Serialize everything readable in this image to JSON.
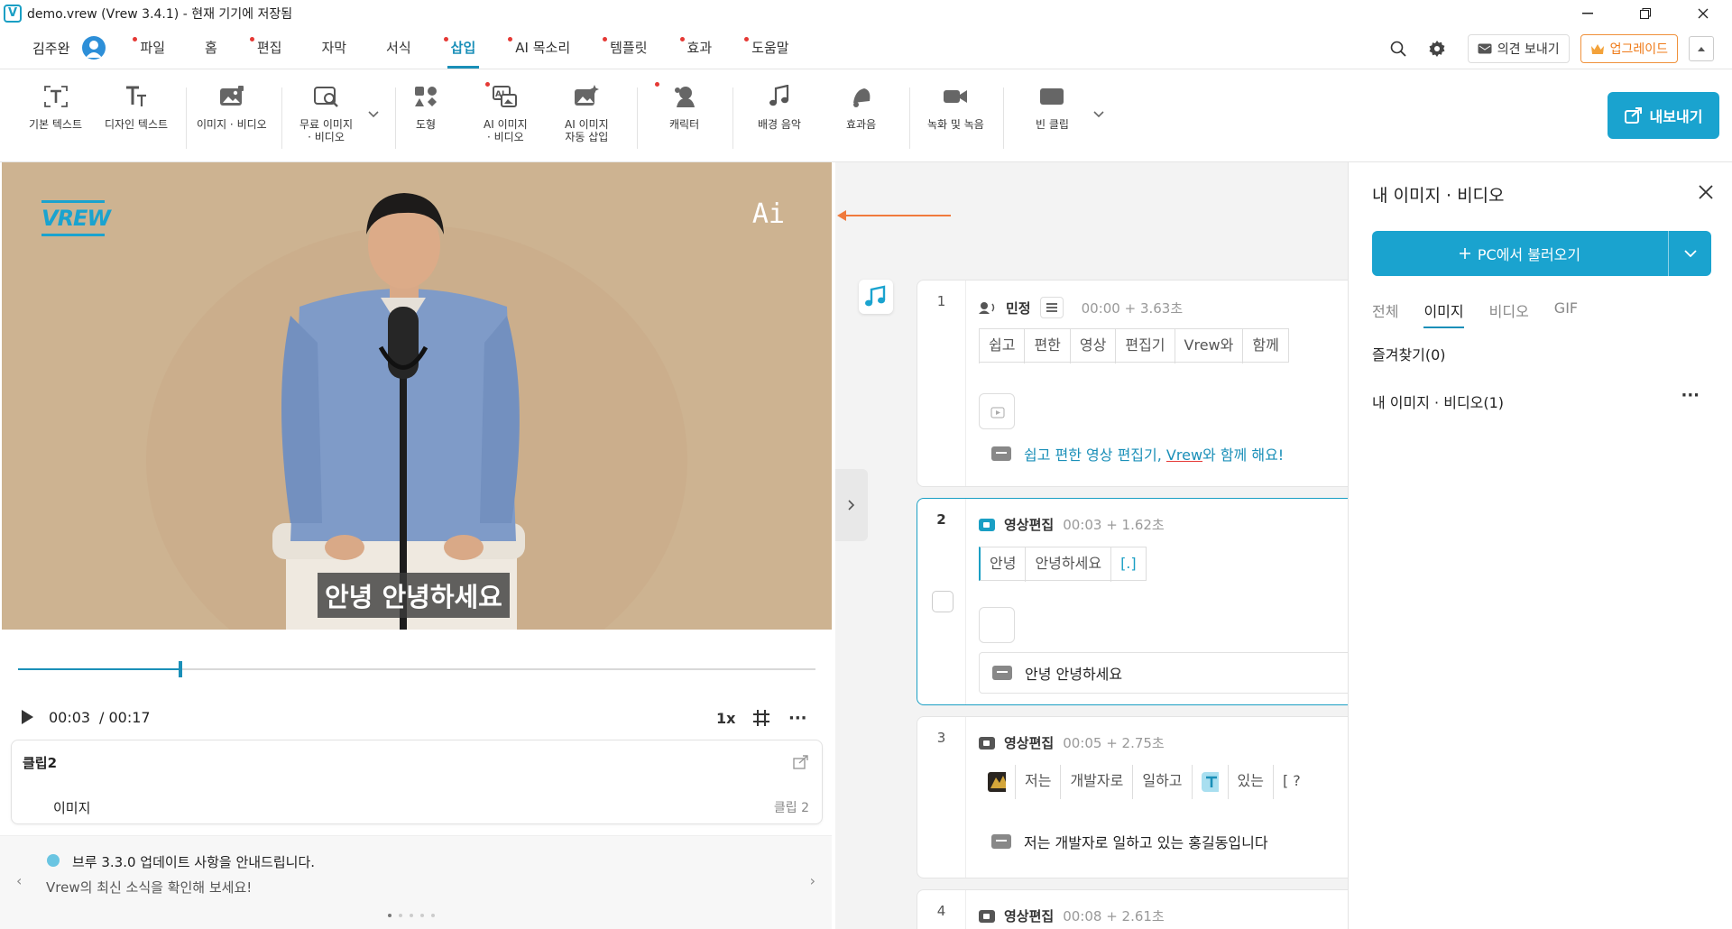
{
  "window": {
    "title": "demo.vrew (Vrew 3.4.1) - 현재 기기에 저장됨",
    "logo": "V"
  },
  "menu": {
    "user_name": "김주완",
    "items": [
      {
        "label": "파일",
        "dot": true
      },
      {
        "label": "홈",
        "dot": false
      },
      {
        "label": "편집",
        "dot": true
      },
      {
        "label": "자막",
        "dot": false
      },
      {
        "label": "서식",
        "dot": false
      },
      {
        "label": "삽입",
        "dot": true,
        "active": true
      },
      {
        "label": "AI 목소리",
        "dot": true
      },
      {
        "label": "템플릿",
        "dot": true
      },
      {
        "label": "효과",
        "dot": true
      },
      {
        "label": "도움말",
        "dot": true
      }
    ],
    "feedback_label": "의견 보내기",
    "upgrade_label": "업그레이드"
  },
  "toolbar": {
    "basic_text": "기본 텍스트",
    "design_text": "디자인 텍스트",
    "image_video": "이미지 · 비디오",
    "free_image_1": "무료 이미지",
    "free_image_2": "· 비디오",
    "shape": "도형",
    "ai_image_1": "AI 이미지",
    "ai_image_2": "· 비디오",
    "ai_auto_1": "AI 이미지",
    "ai_auto_2": "자동 삽입",
    "character": "캐릭터",
    "bgm": "배경 음악",
    "sfx": "효과음",
    "record": "녹화 및 녹음",
    "empty_clip": "빈 클립",
    "export": "내보내기"
  },
  "preview": {
    "logo_text": "VREW",
    "ai_text": "Ai",
    "subtitle": "안녕 안녕하세요",
    "progress": 0.204,
    "time_current": "00:03",
    "time_total": "/ 00:17",
    "speed": "1x",
    "more": "···"
  },
  "clip_card": {
    "title": "클립2",
    "item": "이미지",
    "clip_label": "클립 2"
  },
  "news": {
    "title": "브루 3.3.0 업데이트 사항을 안내드립니다.",
    "subtitle": "Vrew의 최신 소식을 확인해 보세요!",
    "prev": "‹",
    "next": "›"
  },
  "clips": [
    {
      "num": "1",
      "speaker": "민정",
      "time": "00:00 + 3.63초",
      "words": [
        "쉽고",
        "편한",
        "영상",
        "편집기",
        "Vrew와",
        "함께"
      ],
      "caption_a": "쉽고 편한 영상 편집기, ",
      "caption_b": "Vrew",
      "caption_c": "와 함께 해요!"
    },
    {
      "num": "2",
      "speaker": "영상편집",
      "time": "00:03 + 1.62초",
      "words": [
        "안녕",
        "안녕하세요",
        "[.]"
      ],
      "caption": "안녕 안녕하세요"
    },
    {
      "num": "3",
      "speaker": "영상편집",
      "time": "00:05 + 2.75초",
      "words": [
        "저는",
        "개발자로",
        "일하고",
        "있는",
        "[ ?"
      ],
      "caption": "저는 개발자로 일하고 있는 홍길동입니다"
    },
    {
      "num": "4",
      "speaker": "영상편집",
      "time": "00:08 + 2.61초"
    }
  ],
  "panel": {
    "title": "내 이미지 · 비디오",
    "import_label": "PC에서 불러오기",
    "tabs": [
      "전체",
      "이미지",
      "비디오",
      "GIF"
    ],
    "active_tab": 1,
    "favorites": "즐겨찾기(0)",
    "my_media": "내 이미지 · 비디오(1)",
    "more": "···"
  },
  "colors": {
    "accent": "#1aa3cf",
    "arrow": "#f07a3c",
    "upgrade": "#ef7b1a",
    "video_bg": "#cdb391"
  }
}
